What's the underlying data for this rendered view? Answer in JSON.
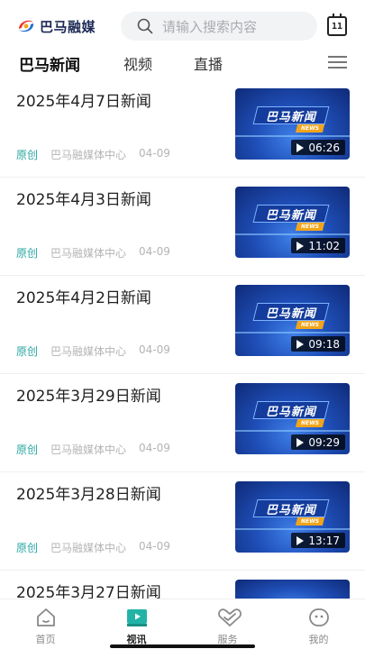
{
  "app": {
    "logo_text": "巴马融媒",
    "search_placeholder": "请输入搜索内容",
    "calendar_day": "11"
  },
  "tabs": [
    {
      "label": "巴马新闻",
      "active": true
    },
    {
      "label": "视频",
      "active": false
    },
    {
      "label": "直播",
      "active": false
    }
  ],
  "news": [
    {
      "title": "2025年4月7日新闻",
      "tag": "原创",
      "source": "巴马融媒体中心",
      "date": "04-09",
      "duration": "06:26",
      "thumb_title": "巴马新闻",
      "thumb_sub": "NEWS"
    },
    {
      "title": "2025年4月3日新闻",
      "tag": "原创",
      "source": "巴马融媒体中心",
      "date": "04-09",
      "duration": "11:02",
      "thumb_title": "巴马新闻",
      "thumb_sub": "NEWS"
    },
    {
      "title": "2025年4月2日新闻",
      "tag": "原创",
      "source": "巴马融媒体中心",
      "date": "04-09",
      "duration": "09:18",
      "thumb_title": "巴马新闻",
      "thumb_sub": "NEWS"
    },
    {
      "title": "2025年3月29日新闻",
      "tag": "原创",
      "source": "巴马融媒体中心",
      "date": "04-09",
      "duration": "09:29",
      "thumb_title": "巴马新闻",
      "thumb_sub": "NEWS"
    },
    {
      "title": "2025年3月28日新闻",
      "tag": "原创",
      "source": "巴马融媒体中心",
      "date": "04-09",
      "duration": "13:17",
      "thumb_title": "巴马新闻",
      "thumb_sub": "NEWS"
    },
    {
      "title": "2025年3月27日新闻",
      "tag": "",
      "source": "",
      "date": "",
      "duration": "",
      "thumb_title": "",
      "thumb_sub": ""
    }
  ],
  "bottom_nav": [
    {
      "label": "首页",
      "icon": "home-icon",
      "active": false
    },
    {
      "label": "视讯",
      "icon": "video-icon",
      "active": true
    },
    {
      "label": "服务",
      "icon": "heart-hands-icon",
      "active": false
    },
    {
      "label": "我的",
      "icon": "smile-face-icon",
      "active": false
    }
  ],
  "colors": {
    "accent": "#2aa7a3",
    "brand": "#1d2a55"
  }
}
